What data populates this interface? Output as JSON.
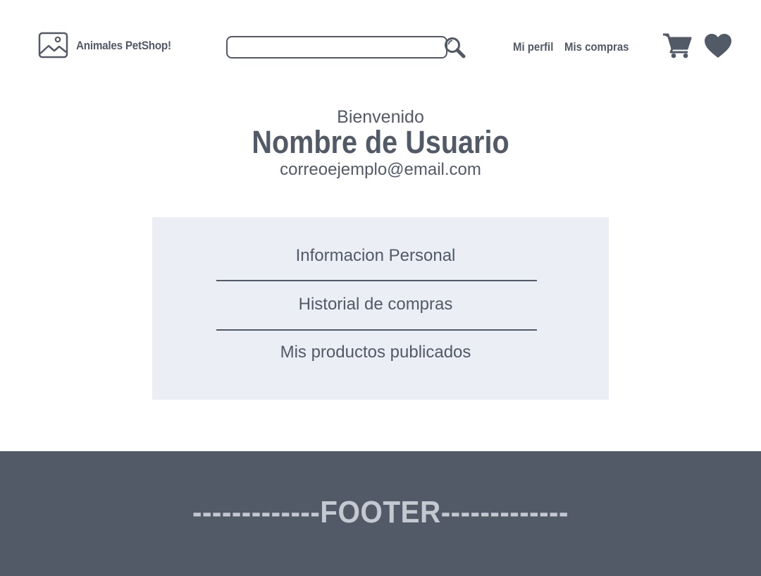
{
  "header": {
    "brand": "Animales PetShop!",
    "search": {
      "value": "",
      "placeholder": ""
    },
    "nav": {
      "profile": "Mi perfil",
      "purchases": "Mis compras"
    },
    "icons": {
      "logo": "image-placeholder-icon",
      "search": "magnifier-icon",
      "cart": "shopping-cart-icon",
      "favorites": "heart-icon"
    }
  },
  "welcome": {
    "label": "Bienvenido",
    "username": "Nombre de Usuario",
    "email": "correoejemplo@email.com"
  },
  "menu": {
    "items": [
      {
        "label": "Informacion Personal"
      },
      {
        "label": "Historial de compras"
      },
      {
        "label": "Mis productos publicados"
      }
    ]
  },
  "footer": {
    "text": "-------------FOOTER-------------"
  },
  "colors": {
    "primary": "#525a67",
    "panel": "#ebeef4",
    "footer_text": "#c4c8d0",
    "background": "#ffffff"
  }
}
